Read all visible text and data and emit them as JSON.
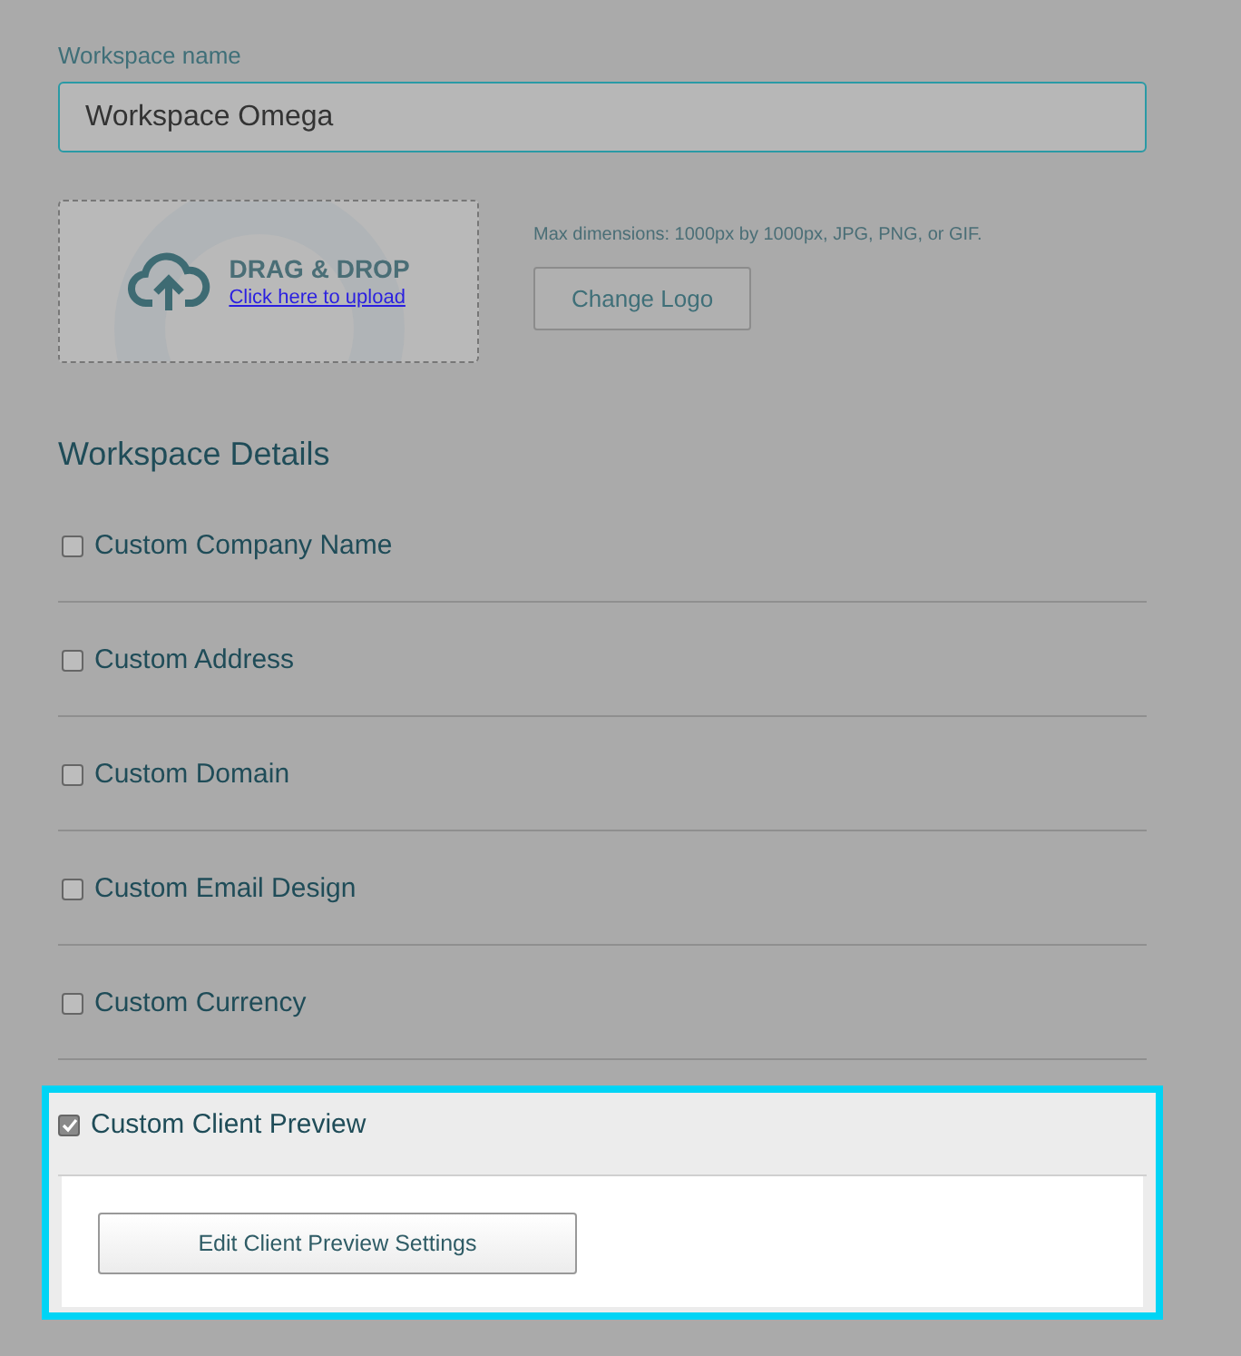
{
  "workspace_name": {
    "label": "Workspace name",
    "value": "Workspace Omega"
  },
  "upload": {
    "title": "DRAG & DROP",
    "link": "Click here to upload",
    "hint": "Max dimensions: 1000px by 1000px, JPG, PNG, or GIF.",
    "button": "Change Logo"
  },
  "details": {
    "heading": "Workspace Details",
    "items": [
      {
        "label": "Custom Company Name",
        "checked": false,
        "highlighted": false
      },
      {
        "label": "Custom Address",
        "checked": false,
        "highlighted": false
      },
      {
        "label": "Custom Domain",
        "checked": false,
        "highlighted": false
      },
      {
        "label": "Custom Email Design",
        "checked": false,
        "highlighted": false
      },
      {
        "label": "Custom Currency",
        "checked": false,
        "highlighted": false
      },
      {
        "label": "Custom Client Preview",
        "checked": true,
        "highlighted": true,
        "action": "Edit Client Preview Settings"
      }
    ]
  }
}
